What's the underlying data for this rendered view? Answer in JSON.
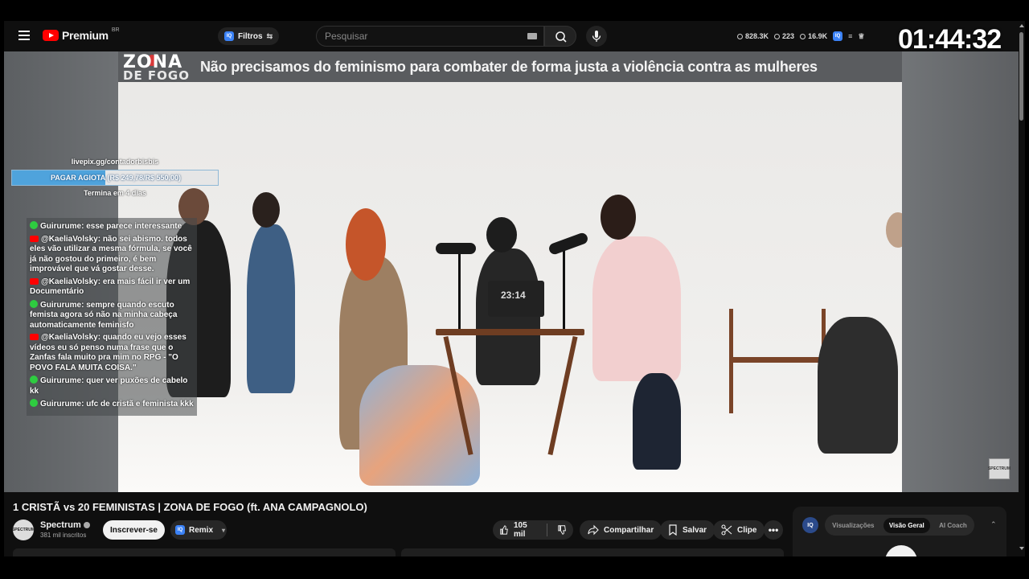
{
  "header": {
    "logo_text": "Premium",
    "logo_region": "BR",
    "filters_label": "Filtros",
    "search_placeholder": "Pesquisar",
    "stats": [
      "828.3K",
      "223",
      "16.9K"
    ],
    "clock": "01:44:32"
  },
  "video": {
    "show_name_top": "ZONA",
    "show_name_bottom": "DE FOGO",
    "banner_title": "Não precisamos do feminismo para combater de forma justa a violência contra as mulheres",
    "laptop_timer": "23:14"
  },
  "overlay": {
    "livepix_url": "livepix.gg/contadorbisbis",
    "pix_goal_label": "PAGAR AGIOTA (R$ 249,78/R$ 550,00)",
    "pix_goal_progress": 0.454,
    "pix_ends": "Termina em 4 dias"
  },
  "chat": [
    {
      "source": "kick",
      "name": "Guirurume:",
      "text": "esse parece interessante"
    },
    {
      "source": "youtube",
      "name": "@KaeliaVolsky:",
      "text": "não sei abismo. todos eles vão utilizar a mesma fórmula, se você já não gostou do primeiro, é bem improvável que vá gostar desse."
    },
    {
      "source": "youtube",
      "name": "@KaeliaVolsky:",
      "text": "era mais fácil ir ver um Documentário"
    },
    {
      "source": "kick",
      "name": "Guirurume:",
      "text": "sempre quando escuto femista agora só não na minha cabeça automaticamente feminisfo"
    },
    {
      "source": "youtube",
      "name": "@KaeliaVolsky:",
      "text": "quando eu vejo esses vídeos eu só penso numa frase que o Zanfas fala muito pra mim no RPG - \"O POVO FALA MUITA COISA.\""
    },
    {
      "source": "kick",
      "name": "Guirurume:",
      "text": "quer ver puxões de cabelo kk"
    },
    {
      "source": "kick",
      "name": "Guirurume:",
      "text": "ufc de cristã e feminista kkk"
    }
  ],
  "below": {
    "video_title": "1 CRISTÃ vs 20 FEMINISTAS | ZONA DE FOGO (ft. ANA CAMPAGNOLO)",
    "channel_name": "Spectrum",
    "subscribers": "381 mil inscritos",
    "subscribe_label": "Inscrever-se",
    "remix_label": "Remix",
    "likes": "105 mil",
    "share_label": "Compartilhar",
    "save_label": "Salvar",
    "clip_label": "Clipe",
    "more_label": "•••"
  },
  "iq_panel": {
    "logo": "IQ",
    "tabs": [
      "Visualizações",
      "Visão Geral",
      "AI Coach"
    ],
    "active_tab": "Visão Geral"
  },
  "colors": {
    "accent_red": "#ff0000",
    "kick_green": "#2ecc40",
    "pix_blue": "#4fa3dc",
    "background": "#0f0f0f"
  }
}
